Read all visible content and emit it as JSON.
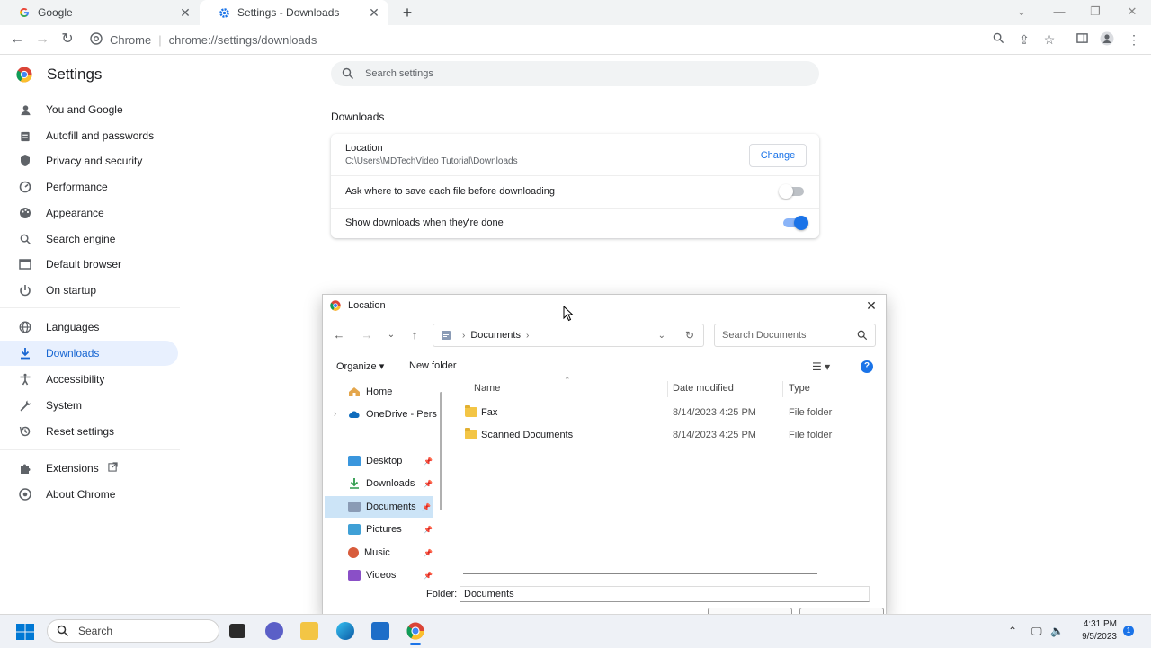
{
  "tabs": [
    {
      "title": "Google",
      "icon": "google-g-icon"
    },
    {
      "title": "Settings - Downloads",
      "icon": "settings-gear-icon"
    }
  ],
  "omnibox": {
    "site_label": "Chrome",
    "url": "chrome://settings/downloads"
  },
  "settings": {
    "title": "Settings",
    "search_placeholder": "Search settings",
    "nav": [
      {
        "label": "You and Google",
        "icon": "person-icon"
      },
      {
        "label": "Autofill and passwords",
        "icon": "clipboard-icon"
      },
      {
        "label": "Privacy and security",
        "icon": "shield-icon"
      },
      {
        "label": "Performance",
        "icon": "speedometer-icon"
      },
      {
        "label": "Appearance",
        "icon": "palette-icon"
      },
      {
        "label": "Search engine",
        "icon": "search-icon"
      },
      {
        "label": "Default browser",
        "icon": "browser-window-icon"
      },
      {
        "label": "On startup",
        "icon": "power-icon"
      },
      {
        "label": "Languages",
        "icon": "globe-icon"
      },
      {
        "label": "Downloads",
        "icon": "download-icon",
        "selected": true
      },
      {
        "label": "Accessibility",
        "icon": "accessibility-icon"
      },
      {
        "label": "System",
        "icon": "wrench-icon"
      },
      {
        "label": "Reset settings",
        "icon": "history-icon"
      },
      {
        "label": "Extensions",
        "icon": "puzzle-icon"
      },
      {
        "label": "About Chrome",
        "icon": "chrome-icon"
      }
    ],
    "downloads": {
      "section_title": "Downloads",
      "location_label": "Location",
      "location_path": "C:\\Users\\MDTechVideo Tutorial\\Downloads",
      "change_label": "Change",
      "ask_label": "Ask where to save each file before downloading",
      "ask_enabled": false,
      "show_label": "Show downloads when they're done",
      "show_enabled": true
    }
  },
  "dialog": {
    "title": "Location",
    "breadcrumb": "Documents",
    "search_placeholder": "Search Documents",
    "organize_label": "Organize",
    "new_folder_label": "New folder",
    "tree": [
      {
        "label": "Home",
        "icon": "home-icon"
      },
      {
        "label": "OneDrive - Pers",
        "icon": "cloud-icon"
      },
      {
        "label": "Desktop",
        "icon": "desktop-icon"
      },
      {
        "label": "Downloads",
        "icon": "download-arrow-icon"
      },
      {
        "label": "Documents",
        "icon": "documents-icon",
        "selected": true
      },
      {
        "label": "Pictures",
        "icon": "pictures-icon"
      },
      {
        "label": "Music",
        "icon": "music-icon"
      },
      {
        "label": "Videos",
        "icon": "videos-icon"
      }
    ],
    "columns": [
      "Name",
      "Date modified",
      "Type"
    ],
    "files": [
      {
        "name": "Fax",
        "date": "8/14/2023 4:25 PM",
        "type": "File folder"
      },
      {
        "name": "Scanned Documents",
        "date": "8/14/2023 4:25 PM",
        "type": "File folder"
      }
    ],
    "folder_label": "Folder:",
    "folder_value": "Documents"
  },
  "taskbar": {
    "search_label": "Search",
    "time": "4:31 PM",
    "date": "9/5/2023",
    "notification_count": "1"
  },
  "colors": {
    "accent": "#1a73e8",
    "selected_bg": "#e8f0fe"
  }
}
